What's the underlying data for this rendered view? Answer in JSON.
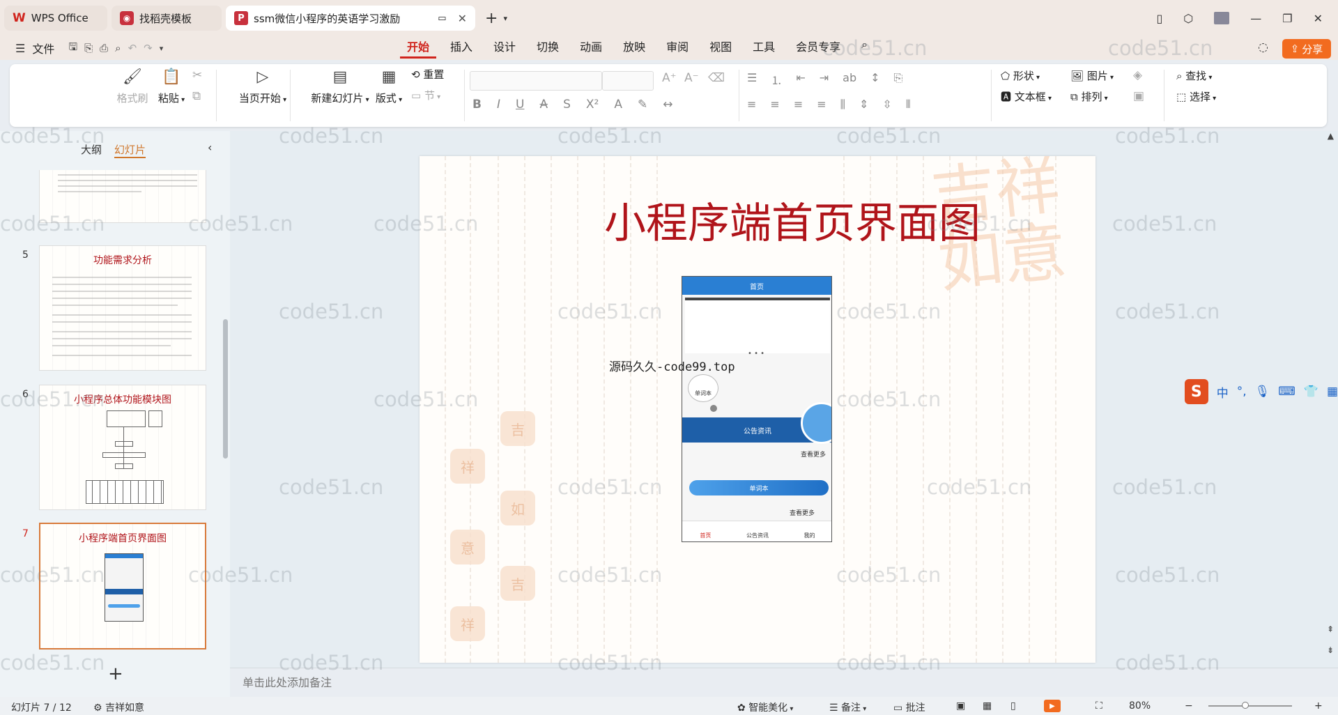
{
  "tabs": [
    {
      "label": "WPS Office",
      "icon": "wps-logo-icon",
      "active": false
    },
    {
      "label": "找稻壳模板",
      "icon": "docer-icon",
      "active": false
    },
    {
      "label": "ssm微信小程序的英语学习激励",
      "icon": "presentation-icon",
      "active": true
    }
  ],
  "menu": {
    "file": "文件",
    "items": [
      "开始",
      "插入",
      "设计",
      "切换",
      "动画",
      "放映",
      "审阅",
      "视图",
      "工具",
      "会员专享"
    ],
    "active": "开始",
    "share": "分享"
  },
  "ribbon": {
    "format_painter": "格式刷",
    "paste": "粘贴",
    "from_start": "当页开始",
    "new_slide": "新建幻灯片",
    "layout": "版式",
    "reset": "重置",
    "section": "节",
    "shape": "形状",
    "picture": "图片",
    "textbox": "文本框",
    "arrange": "排列",
    "find": "查找",
    "select": "选择"
  },
  "panel": {
    "tab_outline": "大纲",
    "tab_slides": "幻灯片",
    "thumbs": [
      {
        "num": "5",
        "title": "功能需求分析"
      },
      {
        "num": "6",
        "title": "小程序总体功能模块图"
      },
      {
        "num": "7",
        "title": "小程序端首页界面图"
      }
    ]
  },
  "slide": {
    "title": "小程序端首页界面图",
    "overlay": "源码久久-code99.top",
    "phone": {
      "header": "首页",
      "category": "单词本",
      "notice": "公告资讯",
      "more1": "查看更多",
      "bar": "单词本",
      "more2": "查看更多",
      "tab_home": "首页",
      "tab_news": "公告资讯",
      "tab_me": "我的"
    }
  },
  "notes_placeholder": "单击此处添加备注",
  "status": {
    "slide_count": "幻灯片 7 / 12",
    "theme": "吉祥如意",
    "beautify": "智能美化",
    "notes": "备注",
    "comment": "批注",
    "zoom": "80%"
  },
  "ime": {
    "lang": "中"
  },
  "watermark": "code51.cn",
  "colors": {
    "accent": "#d0241d",
    "share": "#f26b1f",
    "phone_header": "#2a7fd3"
  }
}
